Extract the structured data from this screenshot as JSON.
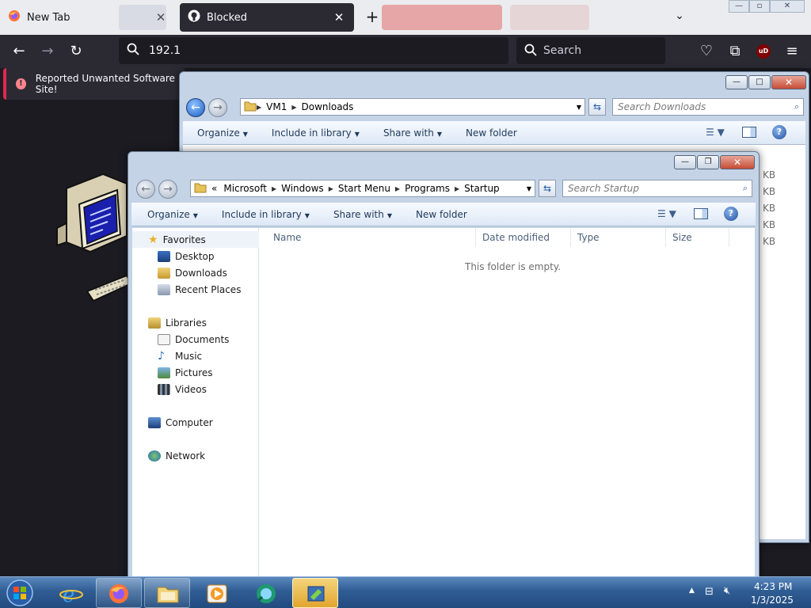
{
  "browser": {
    "tabs": [
      {
        "title": "New Tab"
      },
      {
        "title": "Blocked"
      }
    ],
    "url": "192.1",
    "search_placeholder": "Search",
    "notification": "Reported Unwanted Software Site!",
    "ublock_label": "uD"
  },
  "back_window": {
    "address": [
      "VM1",
      "Downloads"
    ],
    "search_placeholder": "Search Downloads",
    "toolbar": [
      "Organize",
      "Include in library",
      "Share with",
      "New folder"
    ],
    "size_unit": "KB"
  },
  "front_window": {
    "address": [
      "Microsoft",
      "Windows",
      "Start Menu",
      "Programs",
      "Startup"
    ],
    "address_prefix": "«",
    "search_placeholder": "Search Startup",
    "toolbar": [
      "Organize",
      "Include in library",
      "Share with",
      "New folder"
    ],
    "nav": {
      "favorites": "Favorites",
      "favorites_items": [
        "Desktop",
        "Downloads",
        "Recent Places"
      ],
      "libraries": "Libraries",
      "libraries_items": [
        "Documents",
        "Music",
        "Pictures",
        "Videos"
      ],
      "computer": "Computer",
      "network": "Network"
    },
    "columns": [
      "Name",
      "Date modified",
      "Type",
      "Size"
    ],
    "empty_message": "This folder is empty."
  },
  "taskbar": {
    "time": "4:23 PM",
    "date": "1/3/2025"
  },
  "colors": {
    "browser_dark": "#2b2a33",
    "browser_tabbar": "#ebecef",
    "error_red": "#e22850",
    "win_frame": "#c4d3e6",
    "taskbar": "#2f5d93"
  }
}
